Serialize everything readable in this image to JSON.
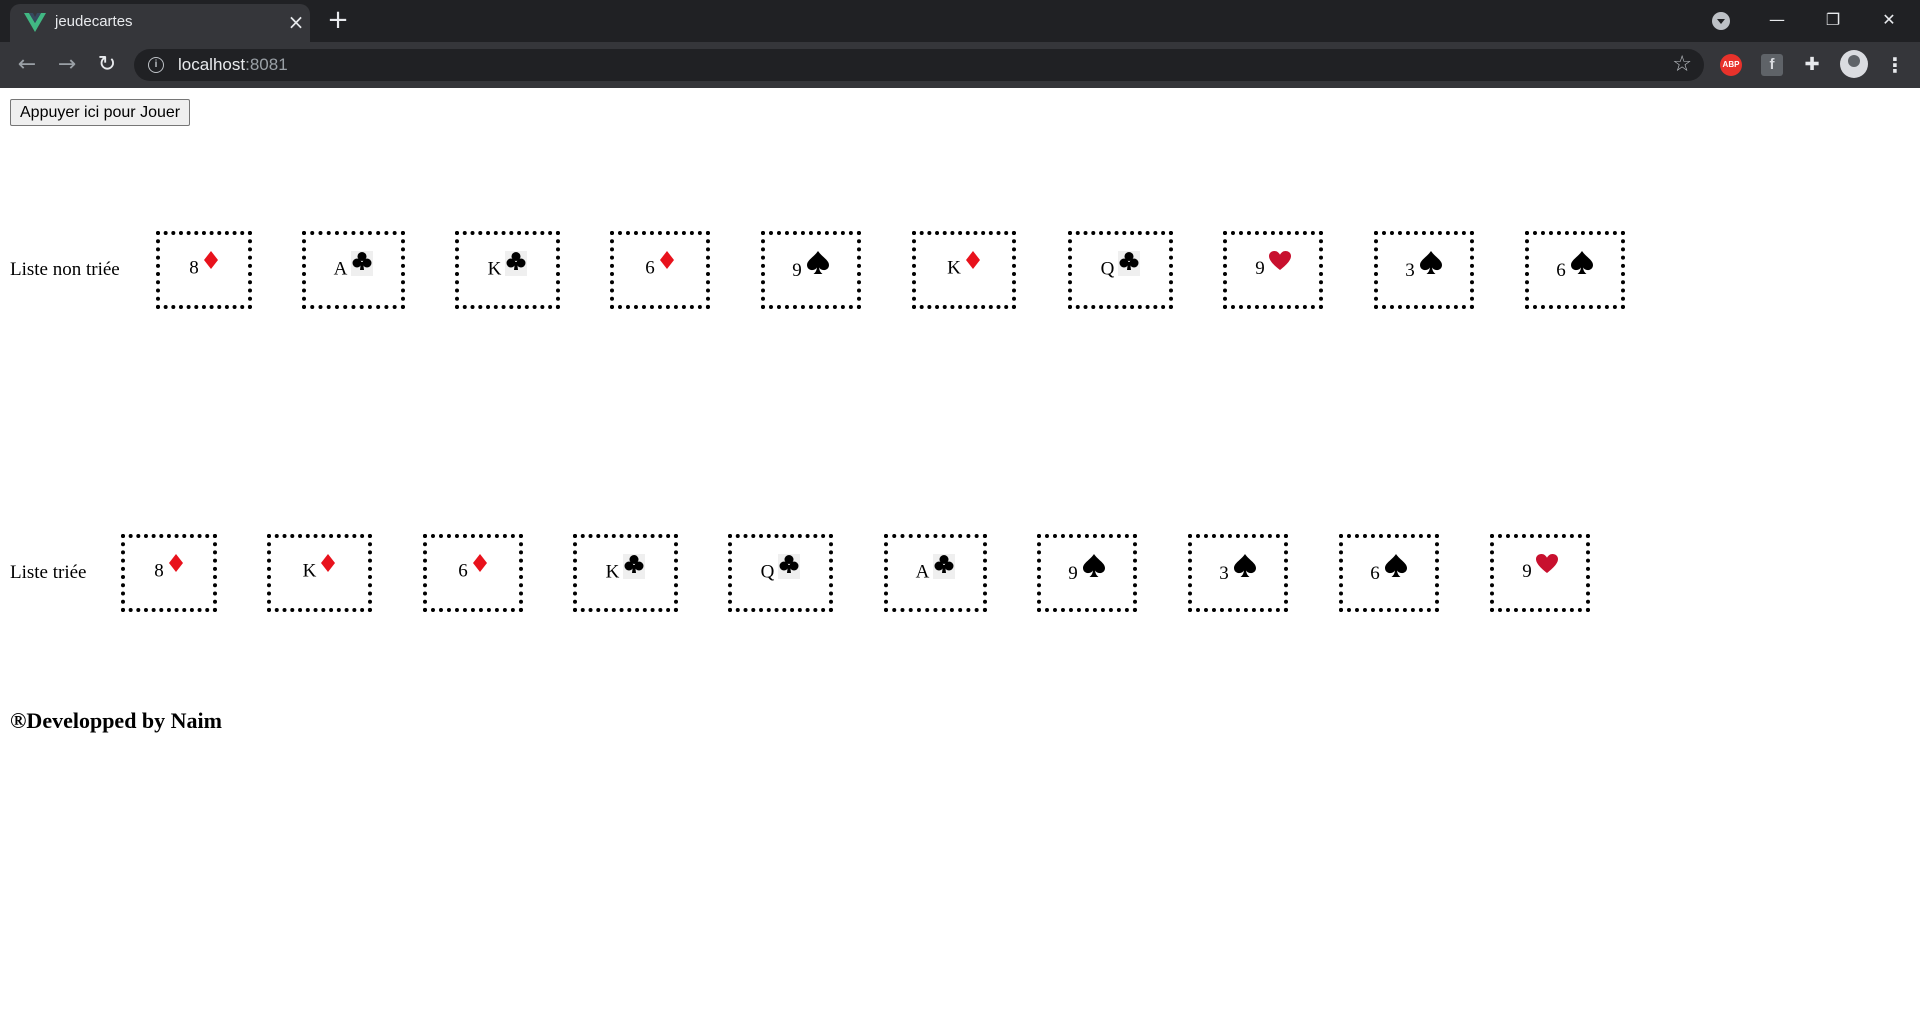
{
  "browser": {
    "tab_title": "jeudecartes",
    "url_host": "localhost",
    "url_port": ":8081",
    "extensions": {
      "abp_label": "ABP",
      "fb_label": "f"
    }
  },
  "play_button_label": "Appuyer ici pour Jouer",
  "unsorted": {
    "label": "Liste non triée",
    "cards": [
      {
        "rank": "8",
        "suit": "diamonds"
      },
      {
        "rank": "A",
        "suit": "clubs"
      },
      {
        "rank": "K",
        "suit": "clubs"
      },
      {
        "rank": "6",
        "suit": "diamonds"
      },
      {
        "rank": "9",
        "suit": "spades"
      },
      {
        "rank": "K",
        "suit": "diamonds"
      },
      {
        "rank": "Q",
        "suit": "clubs"
      },
      {
        "rank": "9",
        "suit": "hearts"
      },
      {
        "rank": "3",
        "suit": "spades"
      },
      {
        "rank": "6",
        "suit": "spades"
      }
    ]
  },
  "sorted": {
    "label": "Liste triée",
    "cards": [
      {
        "rank": "8",
        "suit": "diamonds"
      },
      {
        "rank": "K",
        "suit": "diamonds"
      },
      {
        "rank": "6",
        "suit": "diamonds"
      },
      {
        "rank": "K",
        "suit": "clubs"
      },
      {
        "rank": "Q",
        "suit": "clubs"
      },
      {
        "rank": "A",
        "suit": "clubs"
      },
      {
        "rank": "9",
        "suit": "spades"
      },
      {
        "rank": "3",
        "suit": "spades"
      },
      {
        "rank": "6",
        "suit": "spades"
      },
      {
        "rank": "9",
        "suit": "hearts"
      }
    ]
  },
  "footer": "®Developped by Naim",
  "suit_colors": {
    "diamonds": "#e8121c",
    "hearts": "#c8102e",
    "clubs": "#000000",
    "spades": "#000000"
  }
}
